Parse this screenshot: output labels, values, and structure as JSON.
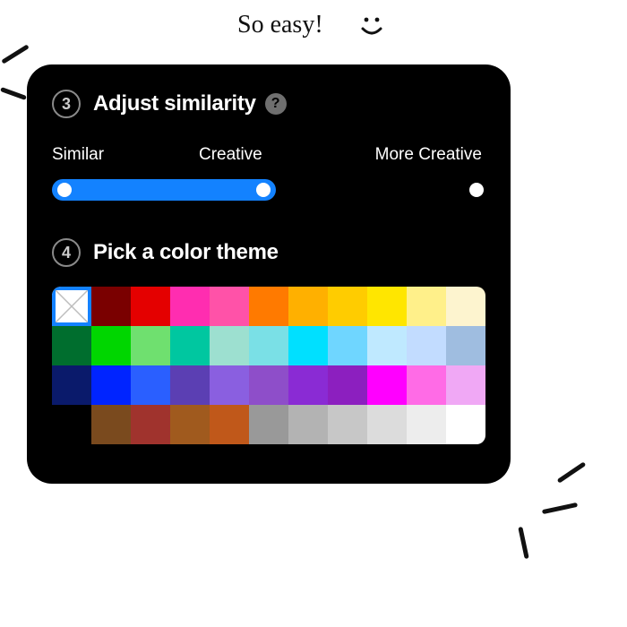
{
  "annotation": {
    "text": "So easy!"
  },
  "panel": {
    "step3": {
      "number": "3",
      "title": "Adjust similarity",
      "help": "?",
      "labels": {
        "left": "Similar",
        "mid": "Creative",
        "right": "More Creative"
      }
    },
    "step4": {
      "number": "4",
      "title": "Pick a color theme"
    }
  },
  "palette": {
    "rows": [
      [
        "none",
        "#7a0000",
        "#e40000",
        "#ff2db0",
        "#ff52a8",
        "#ff7a00",
        "#ffb000",
        "#ffcc00",
        "#ffe600",
        "#fff08a",
        "#fdf4cf"
      ],
      [
        "#006e2e",
        "#00d600",
        "#6fe06f",
        "#00c7a0",
        "#9de0d0",
        "#7ae0e6",
        "#00e0ff",
        "#6fd6ff",
        "#bfe9ff",
        "#c2dcff",
        "#9fbde0"
      ],
      [
        "#0a1a6b",
        "#0024ff",
        "#2a5fff",
        "#5b3fb3",
        "#8a5fe0",
        "#8e4ec9",
        "#8a2bd4",
        "#8c1fbf",
        "#ff00ff",
        "#ff6be6",
        "#f0a8f5"
      ],
      [
        "none-blank",
        "#7a4a1e",
        "#a0332d",
        "#a05a1e",
        "#c0581a",
        "#999999",
        "#b3b3b3",
        "#c7c7c7",
        "#dcdcdc",
        "#ededed",
        "#ffffff"
      ]
    ]
  }
}
